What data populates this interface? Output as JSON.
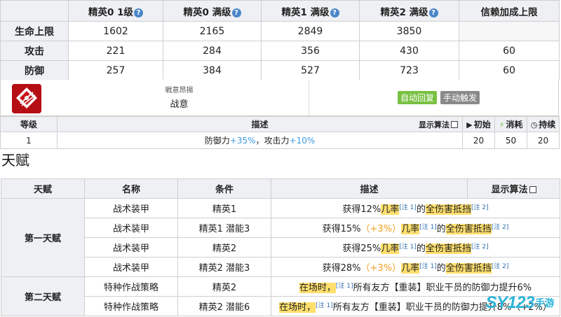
{
  "stats": {
    "headers": [
      "",
      "精英0 1级",
      "精英0 满级",
      "精英1 满级",
      "精英2 满级",
      "信赖加成上限"
    ],
    "help_mark": "?",
    "rows": [
      {
        "label": "生命上限",
        "values": [
          "1602",
          "2165",
          "2849",
          "3850",
          ""
        ]
      },
      {
        "label": "攻击",
        "values": [
          "221",
          "284",
          "356",
          "430",
          "60"
        ]
      },
      {
        "label": "防御",
        "values": [
          "257",
          "384",
          "527",
          "723",
          "60"
        ]
      }
    ]
  },
  "skill": {
    "icon": "red-diamond-burst-icon",
    "subtitle": "戦意昂揚",
    "name": "战意",
    "recovery_tag": "自动回复",
    "trigger_tag": "手动触发",
    "colors": {
      "recovery": "#7ac143",
      "trigger": "#8a8a8a",
      "icon_bg": "#c9141a"
    }
  },
  "skill_levels": {
    "headers": {
      "level": "等级",
      "desc": "描述",
      "show_formula": "显示算法",
      "initial": "初始",
      "cost": "消耗",
      "duration": "持续"
    },
    "rows": [
      {
        "level": "1",
        "desc_a": "防御力",
        "desc_b": "+35%",
        "desc_c": "，攻击力",
        "desc_d": "+10%",
        "initial": "20",
        "cost": "50",
        "duration": "20"
      }
    ]
  },
  "talents_section": {
    "title": "天赋",
    "headers": {
      "talent": "天赋",
      "name": "名称",
      "condition": "条件",
      "desc": "描述",
      "show_formula": "显示算法"
    },
    "note1": "[注 1]",
    "note2": "[注 2]",
    "groups": [
      {
        "label": "第一天赋",
        "rows": [
          {
            "name": "战术装甲",
            "condition": "精英1",
            "pre": "获得12%",
            "plus": "",
            "kw1": "几率",
            "mid": "的",
            "kw2": "全伤害抵挡"
          },
          {
            "name": "战术装甲",
            "condition": "精英1 潜能3",
            "pre": "获得15%",
            "plus": "（+3%）",
            "kw1": "几率",
            "mid": "的",
            "kw2": "全伤害抵挡"
          },
          {
            "name": "战术装甲",
            "condition": "精英2",
            "pre": "获得25%",
            "plus": "",
            "kw1": "几率",
            "mid": "的",
            "kw2": "全伤害抵挡"
          },
          {
            "name": "战术装甲",
            "condition": "精英2 潜能3",
            "pre": "获得28%",
            "plus": "（+3%）",
            "kw1": "几率",
            "mid": "的",
            "kw2": "全伤害抵挡"
          }
        ]
      },
      {
        "label": "第二天赋",
        "rows": [
          {
            "name": "特种作战策略",
            "condition": "精英2",
            "kw1": "在场时，",
            "text": "所有友方【重装】职业干员的防御力提升6%"
          },
          {
            "name": "特种作战策略",
            "condition": "精英2 潜能6",
            "kw1": "在场时，",
            "text": "所有友方【重装】职业干员的防御力提升8%（+2%）"
          }
        ]
      }
    ]
  },
  "watermarks": {
    "brand_main": "SY123",
    "brand_cn": "手游"
  }
}
